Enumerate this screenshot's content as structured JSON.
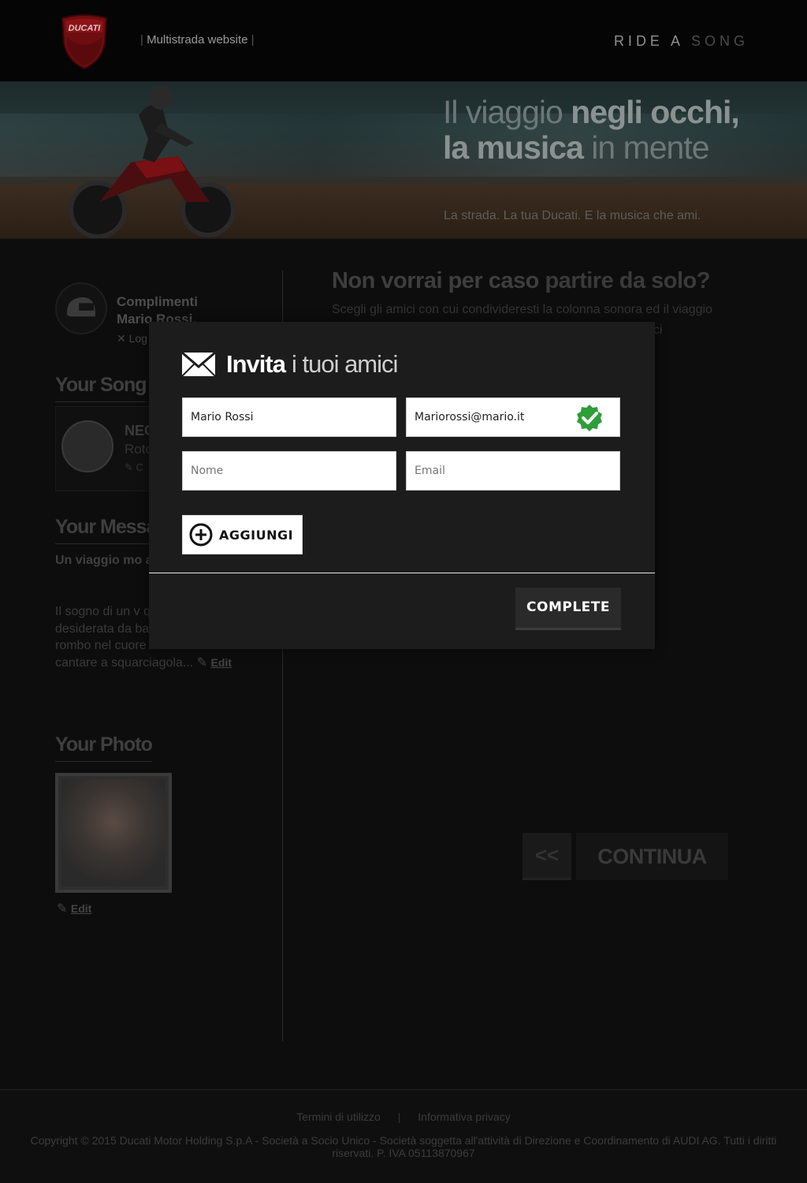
{
  "header": {
    "site_link": "Multistrada website",
    "brand_ride": "RIDE A",
    "brand_song": "SONG",
    "logo_text": "DUCATI"
  },
  "hero": {
    "title_line1_a": "Il viaggio",
    "title_line1_b": "negli occhi,",
    "title_line2_a": "la musica",
    "title_line2_b": "in mente",
    "subtitle": "La strada. La tua Ducati. E la musica che ami."
  },
  "sidebar": {
    "greeting_line1": "Complimenti",
    "greeting_line2": "Mario Rossi,",
    "logout": "✕ Log",
    "song_heading": "Your Song",
    "song_title": "NEG",
    "song_sub": "Roto",
    "song_edit": "✎ C",
    "message_heading": "Your Messa",
    "message_title": "Un viaggio mo al mio spirito.",
    "message_body": "Il sogno di un v quell'America L desiderata da bambini, con un rombo nel cuore e un ritornello da cantare a squarciagola...",
    "edit_label": "Edit",
    "photo_heading": "Your Photo"
  },
  "main": {
    "heading_a": "Non vorrai per caso",
    "heading_b": "partire da solo?",
    "subheading": "Scegli gli amici con cui condivideresti la colonna sonora ed il viaggio",
    "subheading_tail": "ci",
    "back_label": "<<",
    "continue_label": "CONTINUA"
  },
  "modal": {
    "title_a": "Invita",
    "title_b": "i tuoi amici",
    "rows": [
      {
        "name": "Mario Rossi",
        "email": "Mariorossi@mario.it",
        "verified": true
      },
      {
        "name_placeholder": "Nome",
        "email_placeholder": "Email"
      }
    ],
    "add_label": "AGGIUNGI",
    "complete_label": "COMPLETE"
  },
  "footer": {
    "terms": "Termini di utilizzo",
    "separator": "|",
    "privacy": "Informativa privacy",
    "copyright": "Copyright © 2015 Ducati Motor Holding S.p.A - Società a Socio Unico - Società soggetta all'attività di Direzione e Coordinamento di AUDI AG. Tutti i diritti riservati. P. IVA 05113870967"
  },
  "colors": {
    "check_green": "#2e9e3a",
    "ducati_red": "#b3151b"
  }
}
